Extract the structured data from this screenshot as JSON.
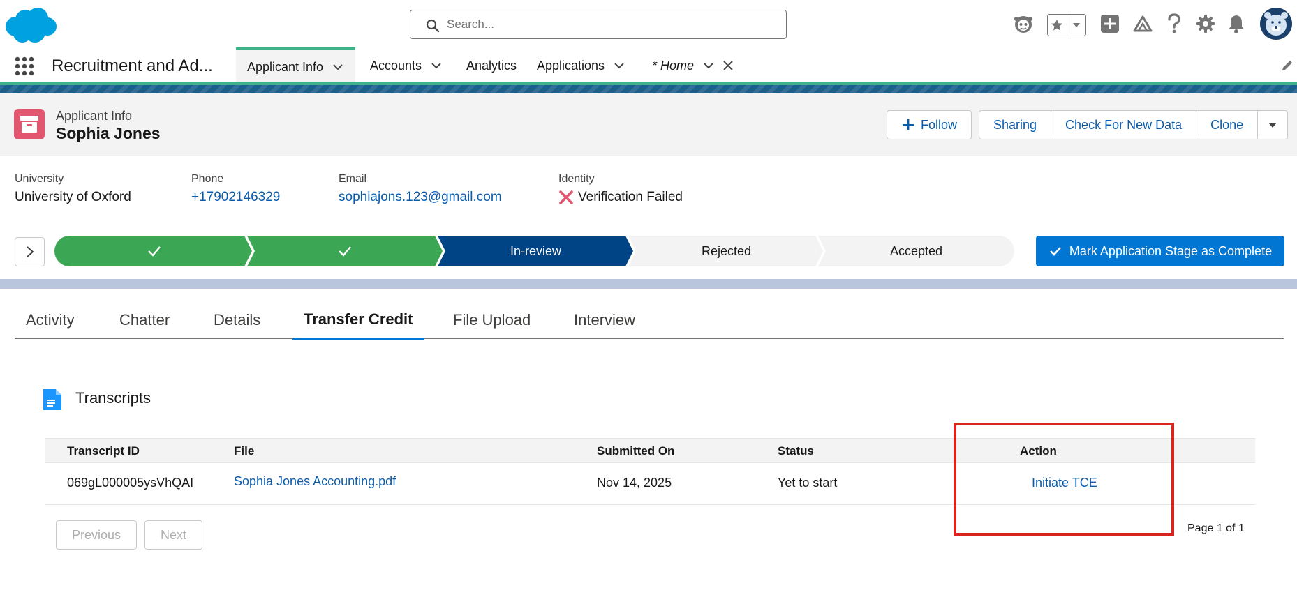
{
  "header": {
    "search_placeholder": "Search...",
    "icons": [
      "salesforce-cloud-logo",
      "search-icon",
      "einstein-icon",
      "favorites-star-icon",
      "favorites-dropdown-icon",
      "global-add-icon",
      "trailhead-icon",
      "help-icon",
      "setup-gear-icon",
      "notifications-bell-icon",
      "user-avatar"
    ]
  },
  "nav": {
    "app_name": "Recruitment and Ad...",
    "items": [
      {
        "label": "Applicant Info",
        "active": true,
        "has_menu": true
      },
      {
        "label": "Accounts",
        "has_menu": true
      },
      {
        "label": "Analytics",
        "has_menu": false
      },
      {
        "label": "Applications",
        "has_menu": true
      },
      {
        "label": "* Home",
        "italic": true,
        "has_menu": true,
        "closable": true
      }
    ]
  },
  "record": {
    "object_type": "Applicant Info",
    "name": "Sophia Jones",
    "actions": {
      "follow": "Follow",
      "sharing": "Sharing",
      "check_new_data": "Check For New Data",
      "clone": "Clone"
    }
  },
  "highlights": [
    {
      "label": "University",
      "value": "University of Oxford"
    },
    {
      "label": "Phone",
      "value": "+17902146329"
    },
    {
      "label": "Email",
      "value": "sophiajons.123@gmail.com"
    },
    {
      "label": "Identity",
      "value": "Verification Failed"
    }
  ],
  "path": {
    "stages": [
      {
        "label": "",
        "status": "complete"
      },
      {
        "label": "",
        "status": "complete"
      },
      {
        "label": "In-review",
        "status": "current"
      },
      {
        "label": "Rejected",
        "status": "incomplete"
      },
      {
        "label": "Accepted",
        "status": "incomplete"
      }
    ],
    "mark_complete_label": "Mark Application Stage as Complete",
    "colors": {
      "complete": "#3ba755",
      "current": "#014486",
      "incomplete": "#f3f3f3",
      "button": "#0176d3"
    }
  },
  "tabs": [
    {
      "label": "Activity"
    },
    {
      "label": "Chatter"
    },
    {
      "label": "Details"
    },
    {
      "label": "Transfer Credit",
      "active": true
    },
    {
      "label": "File Upload"
    },
    {
      "label": "Interview"
    }
  ],
  "transcripts": {
    "title": "Transcripts",
    "columns": [
      "Transcript ID",
      "File",
      "Submitted On",
      "Status",
      "Action"
    ],
    "rows": [
      {
        "transcript_id": "069gL000005ysVhQAI",
        "file": "Sophia Jones Accounting.pdf",
        "submitted_on": "Nov 14, 2025",
        "status": "Yet to start",
        "action": "Initiate TCE"
      }
    ],
    "previous_label": "Previous",
    "next_label": "Next",
    "page_info": "Page 1 of 1"
  },
  "annotation": {
    "color": "#d9251d"
  }
}
